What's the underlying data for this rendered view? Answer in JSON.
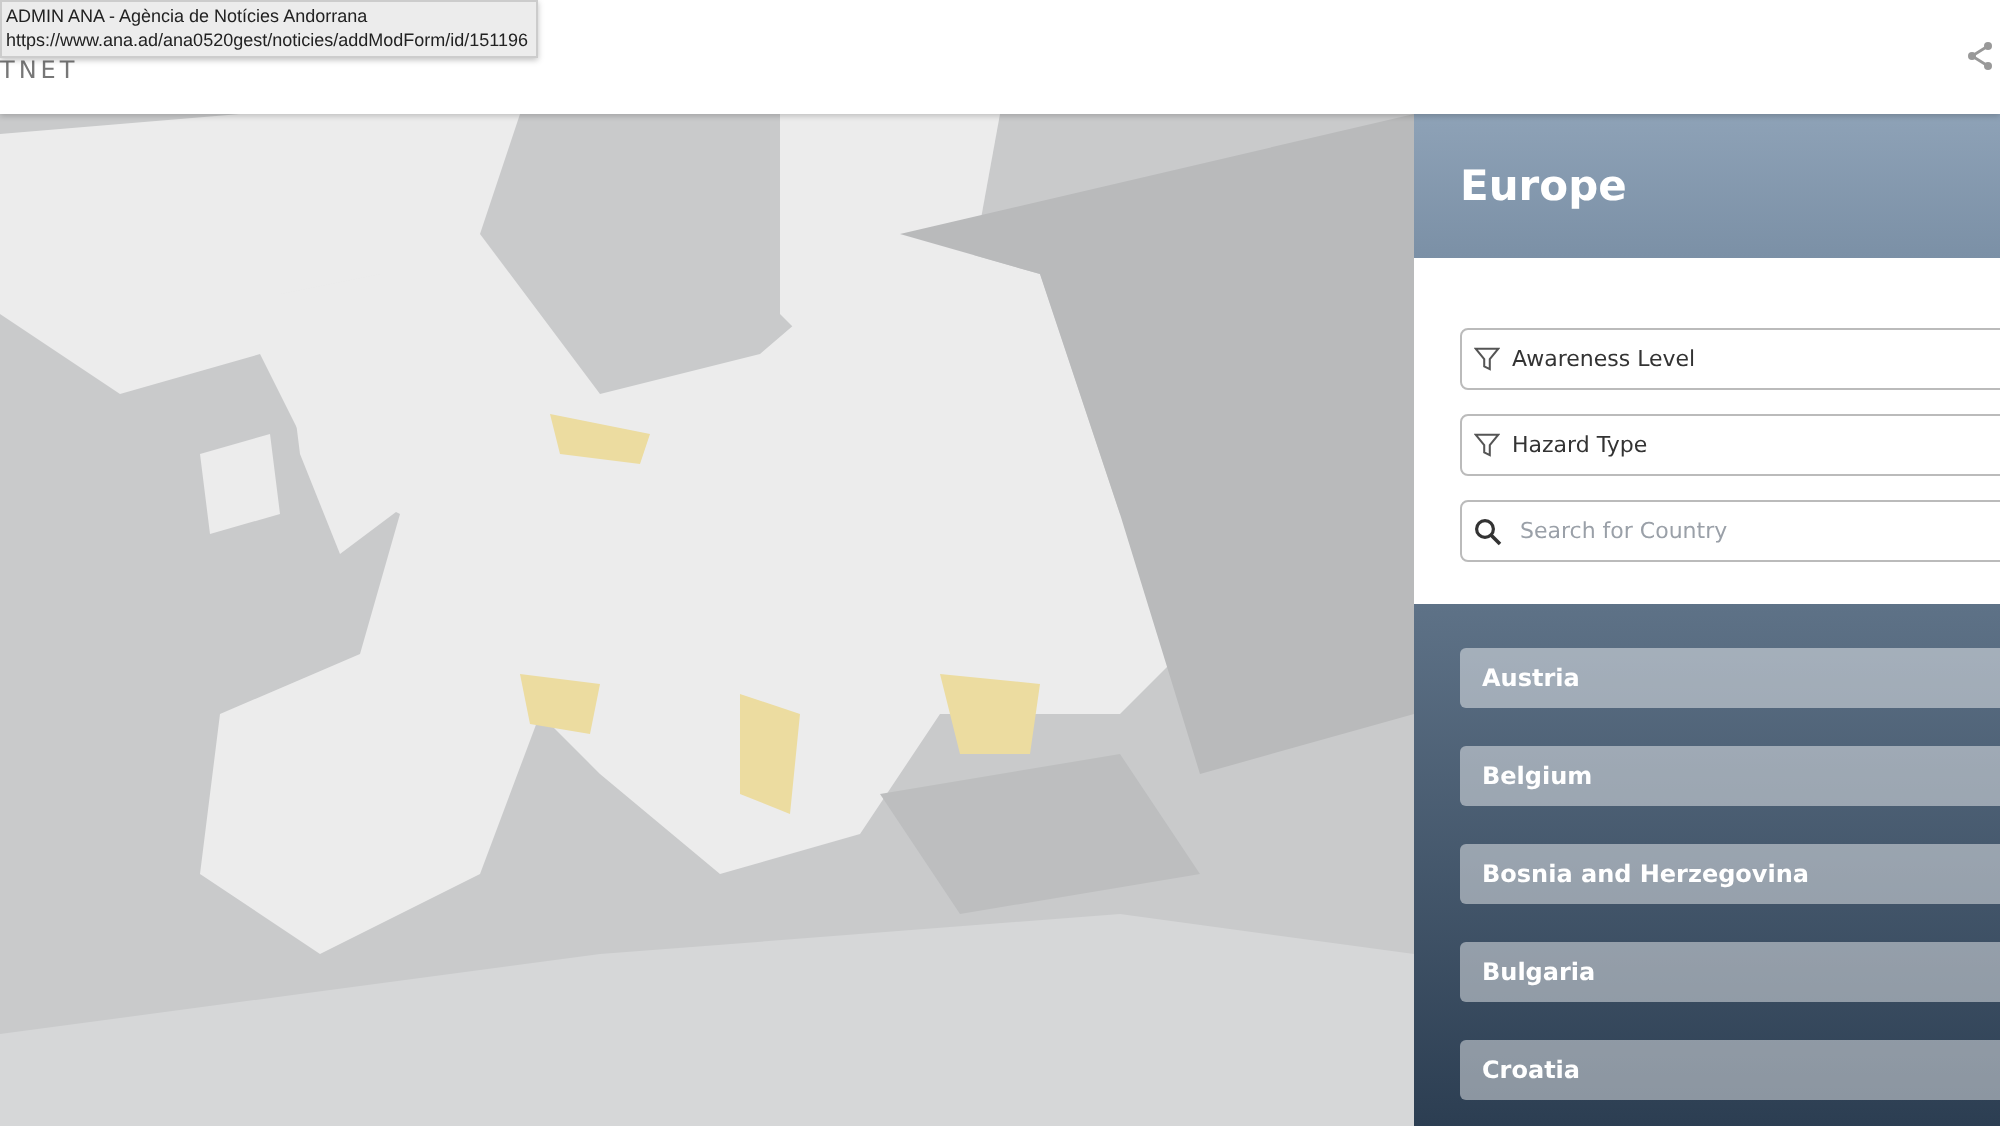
{
  "header": {
    "logo_text": "TNET",
    "tooltip": {
      "title": "ADMIN ANA - Agència de Notícies Andorrana",
      "url": "https://www.ana.ad/ana0520gest/noticies/addModForm/id/151196"
    }
  },
  "panel": {
    "title": "Europe",
    "filters": [
      {
        "kind": "filter",
        "label": "Awareness Level"
      },
      {
        "kind": "filter",
        "label": "Hazard Type"
      },
      {
        "kind": "search",
        "placeholder": "Search for Country"
      }
    ],
    "countries": [
      "Austria",
      "Belgium",
      "Bosnia and Herzegovina",
      "Bulgaria",
      "Croatia"
    ]
  }
}
